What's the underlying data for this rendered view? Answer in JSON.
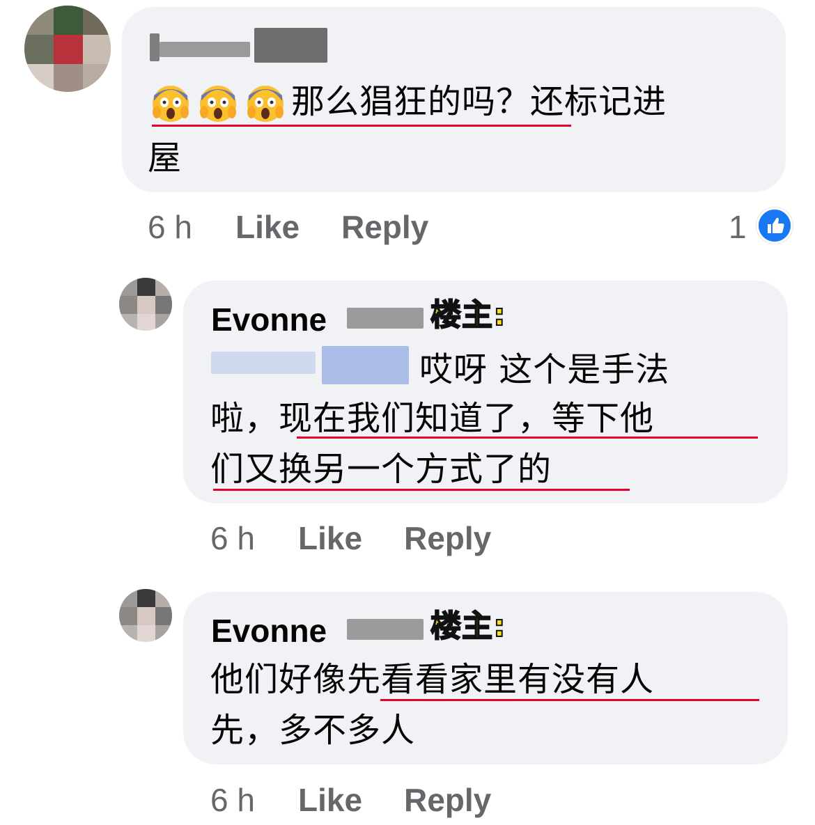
{
  "comments": [
    {
      "author_visible": "",
      "lines": [
        "那么猖狂的吗？还标记进",
        "屋"
      ],
      "emoji_name": "screaming-face-emoji",
      "emoji_count": 3,
      "time": "6 h",
      "like_label": "Like",
      "reply_label": "Reply",
      "reaction_count": "1",
      "reaction_icon": "thumbs-up-icon"
    },
    {
      "author": "Evonne",
      "op_badge": "楼主:",
      "mention_suffix": "哎呀 这个是手法",
      "lines": [
        "啦，现在我们知道了，等下他",
        "们又换另一个方式了的"
      ],
      "time": "6 h",
      "like_label": "Like",
      "reply_label": "Reply"
    },
    {
      "author": "Evonne",
      "op_badge": "楼主:",
      "lines": [
        "他们好像先看看家里有没有人",
        "先，多不多人"
      ],
      "time": "6 h",
      "like_label": "Like",
      "reply_label": "Reply"
    }
  ],
  "colors": {
    "bubble": "#f0f2f5",
    "underline": "#e4002b",
    "meta": "#65676b",
    "badge": "#f7e11b",
    "like_blue": "#1877f2"
  }
}
